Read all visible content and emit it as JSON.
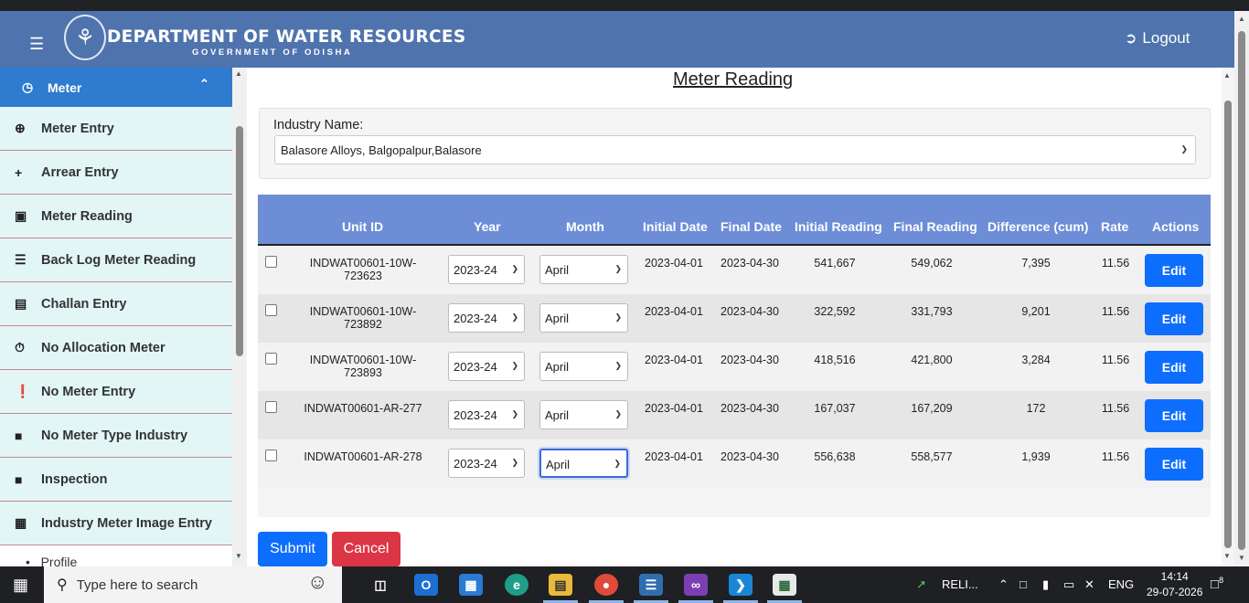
{
  "header": {
    "title": "DEPARTMENT OF WATER RESOURCES",
    "subtitle": "GOVERNMENT OF ODISHA",
    "logout_label": "Logout"
  },
  "sidebar": {
    "section_label": "Meter",
    "items": [
      {
        "label": "Meter Entry",
        "icon": "plus-circle-icon"
      },
      {
        "label": "Arrear Entry",
        "icon": "plus-icon"
      },
      {
        "label": "Meter Reading",
        "icon": "search-card-icon"
      },
      {
        "label": "Back Log Meter Reading",
        "icon": "list-icon"
      },
      {
        "label": "Challan Entry",
        "icon": "document-icon"
      },
      {
        "label": "No Allocation Meter",
        "icon": "timer-icon"
      },
      {
        "label": "No Meter Entry",
        "icon": "alert-icon"
      },
      {
        "label": "No Meter Type Industry",
        "icon": "briefcase-icon"
      },
      {
        "label": "Inspection",
        "icon": "briefcase-icon"
      },
      {
        "label": "Industry Meter Image Entry",
        "icon": "image-add-icon"
      }
    ],
    "extra_item": "Profile"
  },
  "main": {
    "title": "Meter Reading",
    "industry_label": "Industry Name:",
    "industry_value": "Balasore Alloys, Balgopalpur,Balasore",
    "columns": [
      "Unit ID",
      "Year",
      "Month",
      "Initial Date",
      "Final Date",
      "Initial Reading",
      "Final Reading",
      "Difference (cum)",
      "Rate",
      "Actions"
    ],
    "rows": [
      {
        "unit_id": "INDWAT00601-10W-723623",
        "year": "2023-24",
        "month": "April",
        "initial_date": "2023-04-01",
        "final_date": "2023-04-30",
        "initial_reading": "541,667",
        "final_reading": "549,062",
        "difference": "7,395",
        "rate": "11.56",
        "action": "Edit"
      },
      {
        "unit_id": "INDWAT00601-10W-723892",
        "year": "2023-24",
        "month": "April",
        "initial_date": "2023-04-01",
        "final_date": "2023-04-30",
        "initial_reading": "322,592",
        "final_reading": "331,793",
        "difference": "9,201",
        "rate": "11.56",
        "action": "Edit"
      },
      {
        "unit_id": "INDWAT00601-10W-723893",
        "year": "2023-24",
        "month": "April",
        "initial_date": "2023-04-01",
        "final_date": "2023-04-30",
        "initial_reading": "418,516",
        "final_reading": "421,800",
        "difference": "3,284",
        "rate": "11.56",
        "action": "Edit"
      },
      {
        "unit_id": "INDWAT00601-AR-277",
        "year": "2023-24",
        "month": "April",
        "initial_date": "2023-04-01",
        "final_date": "2023-04-30",
        "initial_reading": "167,037",
        "final_reading": "167,209",
        "difference": "172",
        "rate": "11.56",
        "action": "Edit"
      },
      {
        "unit_id": "INDWAT00601-AR-278",
        "year": "2023-24",
        "month": "April",
        "initial_date": "2023-04-01",
        "final_date": "2023-04-30",
        "initial_reading": "556,638",
        "final_reading": "558,577",
        "difference": "1,939",
        "rate": "11.56",
        "action": "Edit"
      }
    ],
    "submit_label": "Submit",
    "cancel_label": "Cancel"
  },
  "taskbar": {
    "search_placeholder": "Type here to search",
    "tray_app_label": "RELI...",
    "language": "ENG",
    "time": "14:14",
    "date": "29-07-2026",
    "notification_count": "8"
  },
  "colors": {
    "header_bg": "#4f73ad",
    "sidebar_active": "#2e7bcf",
    "sidebar_item_bg": "#e3f6f6",
    "table_header_bg": "#6d8ed7",
    "primary": "#0d6efd",
    "danger": "#dc3545"
  }
}
